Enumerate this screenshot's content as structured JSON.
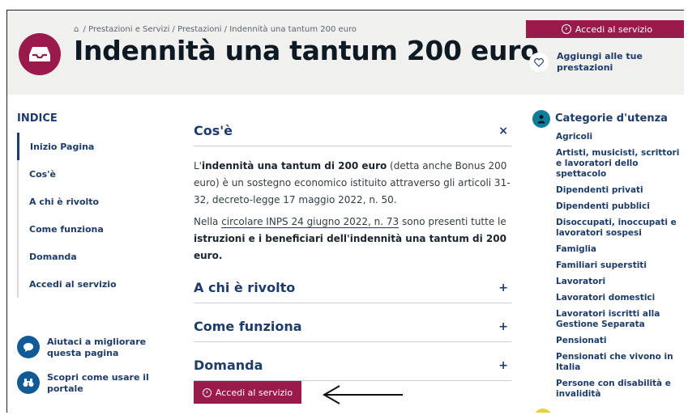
{
  "breadcrumb": {
    "home_icon": "home-icon",
    "path": "/ Prestazioni e Servizi / Prestazioni / Indennità una tantum 200 euro"
  },
  "header": {
    "title": "Indennità una tantum 200 euro",
    "icon": "inbox-icon",
    "access_button": "Accedi al servizio",
    "favorite_label_line1": "Aggiungi alle tue",
    "favorite_label_line2": "prestazioni"
  },
  "index": {
    "title": "INDICE",
    "items": [
      {
        "label": "Inizio Pagina"
      },
      {
        "label": "Cos'è"
      },
      {
        "label": "A chi è rivolto"
      },
      {
        "label": "Come funziona"
      },
      {
        "label": "Domanda"
      },
      {
        "label": "Accedi al servizio"
      }
    ]
  },
  "help": {
    "improve_line1": "Aiutaci a migliorare",
    "improve_line2": "questa pagina",
    "discover_line1": "Scopri come usare il",
    "discover_line2": "portale"
  },
  "main": {
    "sections": [
      {
        "title": "Cos'è",
        "icon": "×"
      },
      {
        "title": "A chi è rivolto",
        "icon": "+"
      },
      {
        "title": "Come funziona",
        "icon": "+"
      },
      {
        "title": "Domanda",
        "icon": "+"
      }
    ],
    "p1_a": "L'",
    "p1_b": "indennità una tantum di 200 euro",
    "p1_c": " (detta anche Bonus 200 euro) è un sostegno economico istituito attraverso gli articoli 31-32, decreto-legge 17 maggio 2022, n. 50.",
    "p2_a": "Nella ",
    "p2_link": "circolare INPS 24 giugno 2022, n. 73",
    "p2_b": " sono presenti tutte le ",
    "p2_c": "istruzioni e i beneficiari dell'indennità una tantum di 200 euro.",
    "access_button": "Accedi al servizio"
  },
  "categories": {
    "title": "Categorie d'utenza",
    "items": [
      "Agricoli",
      "Artisti, musicisti, scrittori e lavoratori dello spettacolo",
      "Dipendenti privati",
      "Dipendenti pubblici",
      "Disoccupati, inoccupati e lavoratori sospesi",
      "Famiglia",
      "Familiari superstiti",
      "Lavoratori",
      "Lavoratori domestici",
      "Lavoratori iscritti alla Gestione Separata",
      "Pensionati",
      "Pensionati che vivono in Italia",
      "Persone con disabilità e invalidità"
    ]
  },
  "colors": {
    "brand": "#9a1b4b",
    "navy": "#1d3c6b",
    "teal": "#0f7d99"
  }
}
